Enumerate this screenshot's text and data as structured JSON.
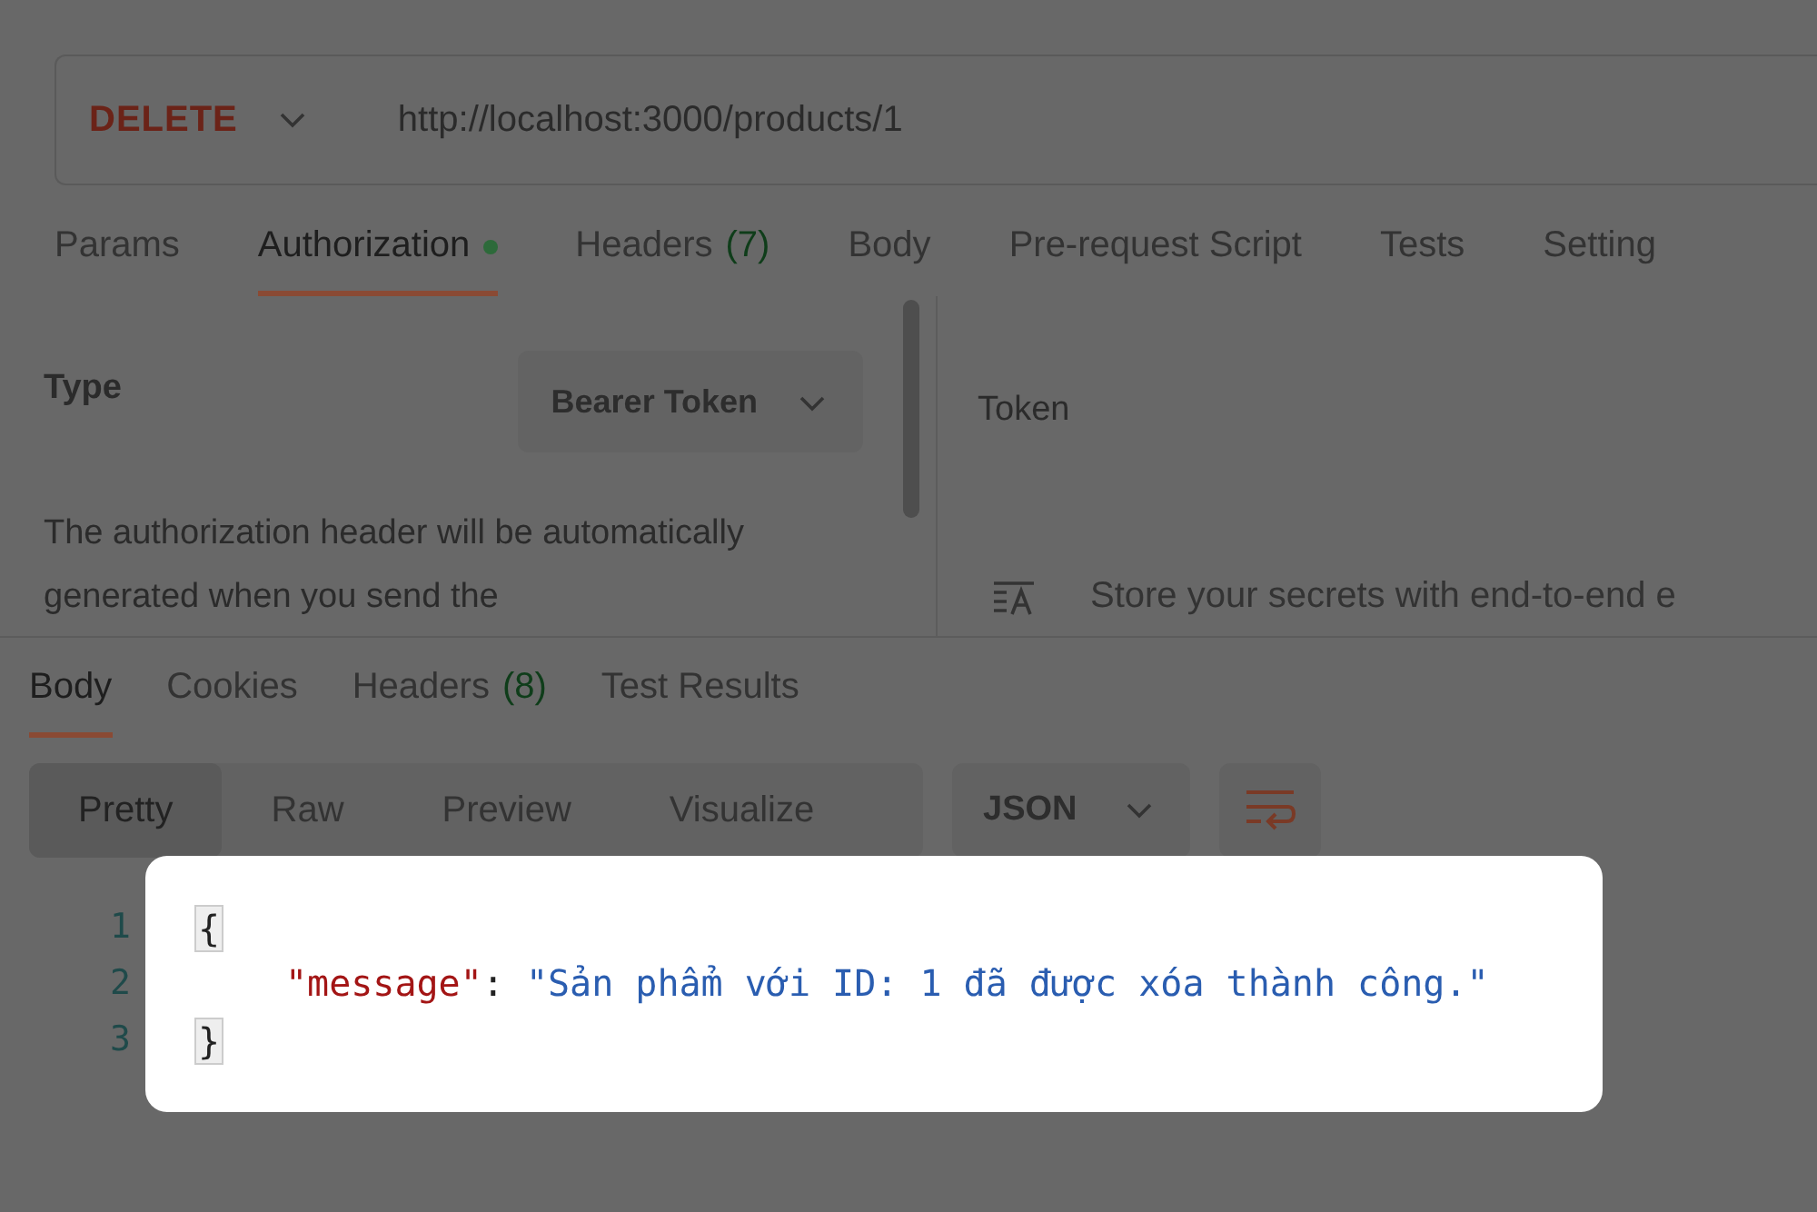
{
  "request": {
    "method": "DELETE",
    "url": "http://localhost:3000/products/1"
  },
  "request_tabs": [
    {
      "label": "Params",
      "selected": false,
      "dot": false
    },
    {
      "label": "Authorization",
      "selected": true,
      "dot": true
    },
    {
      "label": "Headers",
      "count": "(7)",
      "selected": false,
      "dot": false
    },
    {
      "label": "Body",
      "selected": false,
      "dot": false
    },
    {
      "label": "Pre-request Script",
      "selected": false,
      "dot": false
    },
    {
      "label": "Tests",
      "selected": false,
      "dot": false
    },
    {
      "label": "Setting",
      "selected": false,
      "dot": false
    }
  ],
  "auth": {
    "type_label": "Type",
    "type_value": "Bearer Token",
    "description": "The authorization header will be automatically generated when you send the",
    "token_label": "Token",
    "vault_text": "Store your secrets with end-to-end e"
  },
  "response_tabs": [
    {
      "label": "Body",
      "selected": true
    },
    {
      "label": "Cookies",
      "selected": false
    },
    {
      "label": "Headers",
      "count": "(8)",
      "selected": false
    },
    {
      "label": "Test Results",
      "selected": false
    }
  ],
  "view_modes": [
    {
      "label": "Pretty",
      "selected": true
    },
    {
      "label": "Raw",
      "selected": false
    },
    {
      "label": "Preview",
      "selected": false
    },
    {
      "label": "Visualize",
      "selected": false
    }
  ],
  "format": "JSON",
  "code_lines": [
    {
      "number": "1",
      "kind": "brace",
      "text": "{"
    },
    {
      "number": "2",
      "kind": "pair",
      "key": "\"message\"",
      "separator": ":",
      "value": "\"Sản phẩm với ID: 1 đã được xóa thành công.\""
    },
    {
      "number": "3",
      "kind": "brace",
      "text": "}"
    }
  ]
}
